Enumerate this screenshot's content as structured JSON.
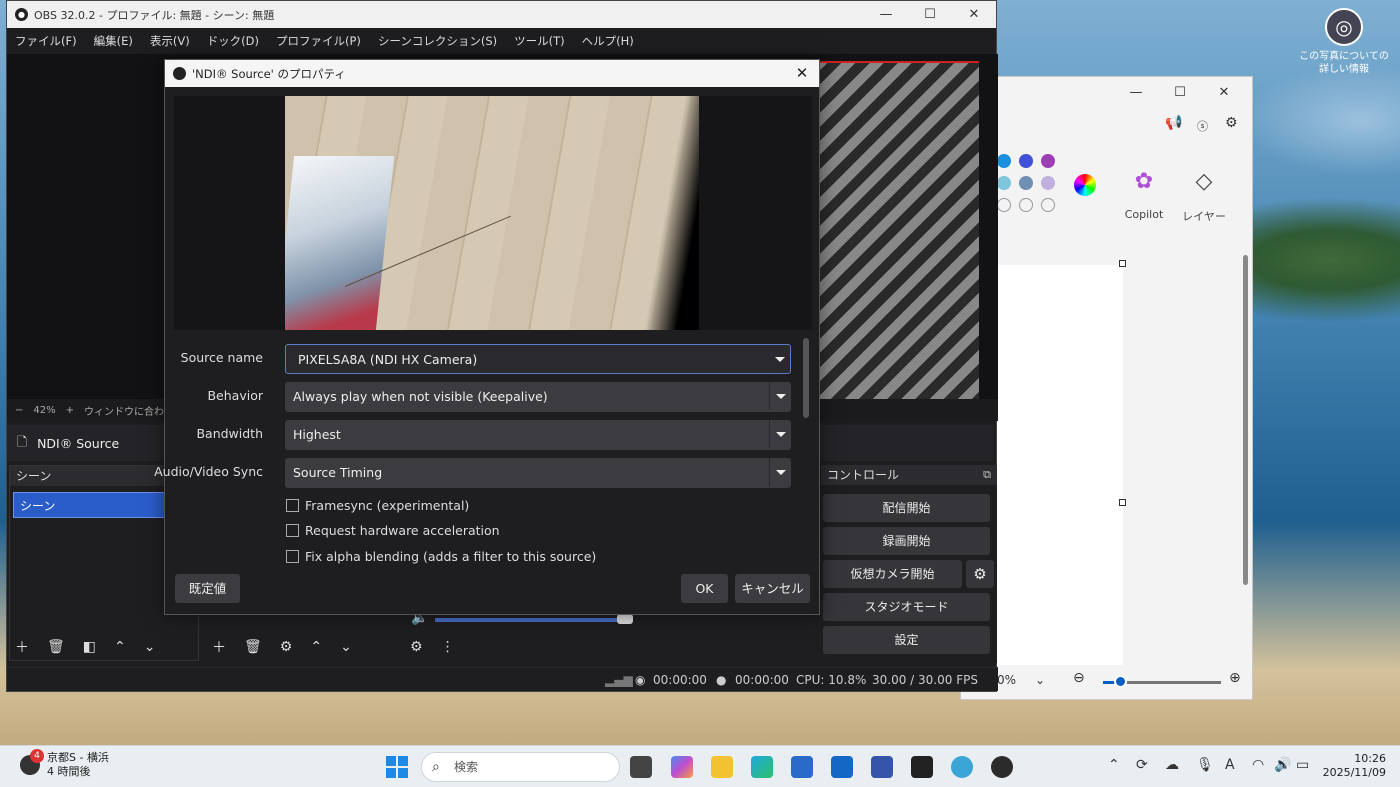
{
  "desktop": {
    "shortcut_label": "この写真についての詳しい情報"
  },
  "paint": {
    "tool_copilot": "Copilot",
    "tool_layers": "レイヤー",
    "zoom_value": "0%",
    "palette": [
      "#1a8fe0",
      "#3f51d6",
      "#9c3fb5",
      "#7fc6dc",
      "#6f8fb3",
      "#c0b0e0"
    ]
  },
  "obs": {
    "title": "OBS 32.0.2 - プロファイル: 無題 - シーン: 無題",
    "menu": [
      "ファイル(F)",
      "編集(E)",
      "表示(V)",
      "ドック(D)",
      "プロファイル(P)",
      "シーンコレクション(S)",
      "ツール(T)",
      "ヘルプ(H)"
    ],
    "zoom_minus": "−",
    "zoom_level": "42%",
    "zoom_plus": "+",
    "zoom_fit": "ウィンドウに合わせ",
    "source_bar_label": "NDI® Source",
    "scenes_title": "シーン",
    "scene_selected": "シーン",
    "controls_title": "コントロール",
    "controls": {
      "stream": "配信開始",
      "record": "録画開始",
      "virtual_cam": "仮想カメラ開始",
      "studio": "スタジオモード",
      "settings": "設定"
    },
    "status": {
      "stream_time": "00:00:00",
      "record_time": "00:00:00",
      "cpu": "CPU: 10.8%",
      "fps": "30.00 / 30.00 FPS"
    }
  },
  "dialog": {
    "title": "'NDI® Source' のプロパティ",
    "fields": {
      "source_name_label": "Source name",
      "source_name_value": "PIXELSA8A (NDI HX Camera)",
      "behavior_label": "Behavior",
      "behavior_value": "Always play when not visible (Keepalive)",
      "bandwidth_label": "Bandwidth",
      "bandwidth_value": "Highest",
      "sync_label": "Audio/Video Sync",
      "sync_value": "Source Timing"
    },
    "checkboxes": {
      "framesync": "Framesync (experimental)",
      "hw_accel": "Request hardware acceleration",
      "alpha": "Fix alpha blending (adds a filter to this source)"
    },
    "buttons": {
      "defaults": "既定値",
      "ok": "OK",
      "cancel": "キャンセル"
    }
  },
  "taskbar": {
    "weather_badge": "4",
    "weather_line1": "京都S - 横浜",
    "weather_line2": "4 時間後",
    "search_placeholder": "検索",
    "time": "10:26",
    "date": "2025/11/09"
  }
}
